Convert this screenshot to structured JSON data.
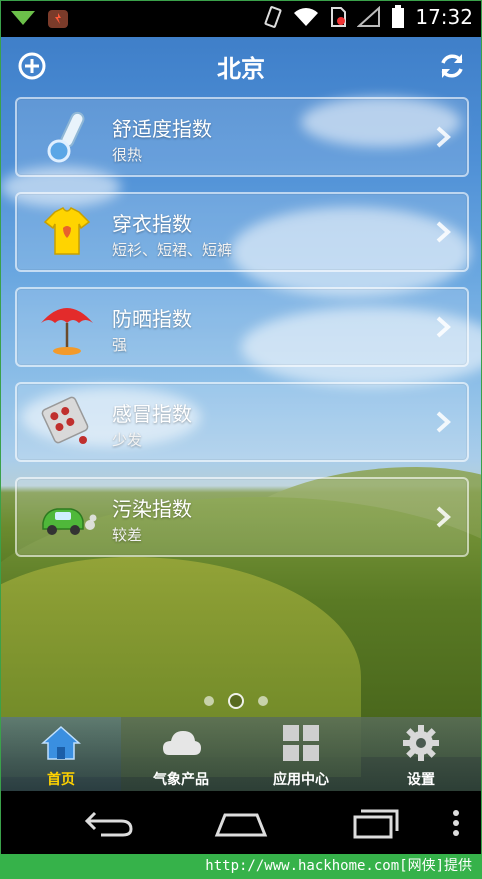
{
  "status_bar": {
    "time": "17:32"
  },
  "header": {
    "title": "北京"
  },
  "cards": [
    {
      "label": "舒适度指数",
      "value": "很热",
      "icon": "thermometer-icon"
    },
    {
      "label": "穿衣指数",
      "value": "短衫、短裙、短裤",
      "icon": "tshirt-icon"
    },
    {
      "label": "防晒指数",
      "value": "强",
      "icon": "umbrella-icon"
    },
    {
      "label": "感冒指数",
      "value": "少发",
      "icon": "pill-icon"
    },
    {
      "label": "污染指数",
      "value": "较差",
      "icon": "car-icon"
    }
  ],
  "pager": {
    "pages": 3,
    "active": 2
  },
  "tabs": [
    {
      "label": "首页",
      "icon": "home-icon",
      "active": true
    },
    {
      "label": "气象产品",
      "icon": "cloud-icon",
      "active": false
    },
    {
      "label": "应用中心",
      "icon": "grid-icon",
      "active": false
    },
    {
      "label": "设置",
      "icon": "gear-icon",
      "active": false
    }
  ],
  "footer": {
    "text": "http://www.hackhome.com[网侠]提供"
  },
  "colors": {
    "footer_bg": "#36b24a",
    "active_tab_label": "#ffd200"
  }
}
